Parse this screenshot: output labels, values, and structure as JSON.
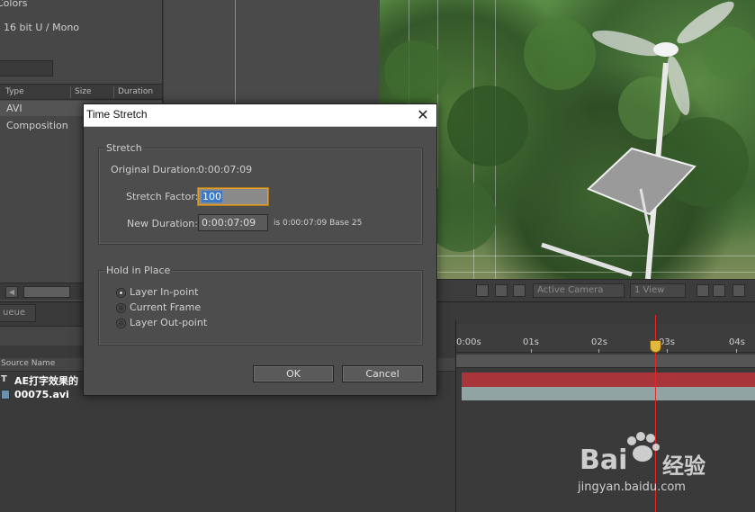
{
  "project_panel": {
    "info_line_1": "Colors",
    "info_line_2": "16 bit U / Mono",
    "columns": [
      "Type",
      "Size",
      "Duration"
    ],
    "rows": [
      "AVI",
      "Composition"
    ]
  },
  "viewer_toolbar": {
    "camera": "Active Camera",
    "view": "1 View"
  },
  "timeline": {
    "tab_label": "ueue",
    "source_name_header": "Source Name",
    "layers": [
      {
        "icon": "T",
        "name": "AE打字效果的"
      },
      {
        "icon": "",
        "name": "00075.avi"
      }
    ],
    "ruler_labels": [
      "0:00s",
      "01s",
      "02s",
      "03s",
      "04s"
    ]
  },
  "dialog": {
    "title": "Time Stretch",
    "close": "✕",
    "stretch": {
      "group_title": "Stretch",
      "original_label": "Original Duration:",
      "original_value": "0:00:07:09",
      "factor_label": "Stretch Factor:",
      "factor_value": "100",
      "new_label": "New Duration:",
      "new_value": "0:00:07:09",
      "new_info": "is 0:00:07:09  Base 25"
    },
    "hold": {
      "group_title": "Hold in Place",
      "options": [
        "Layer In-point",
        "Current Frame",
        "Layer Out-point"
      ],
      "selected_index": 0
    },
    "ok_label": "OK",
    "cancel_label": "Cancel"
  },
  "watermark": {
    "brand_line": "Bai",
    "brand_cn": "经验",
    "url": "jingyan.baidu.com"
  }
}
